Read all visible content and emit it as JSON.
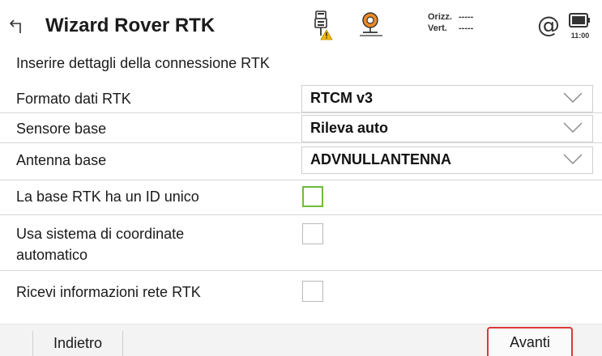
{
  "header": {
    "title": "Wizard Rover RTK",
    "precision": {
      "horizontal_label": "Orizz.",
      "horizontal_value": "-----",
      "vertical_label": "Vert.",
      "vertical_value": "-----"
    },
    "at_symbol": "@",
    "battery_time": "11:00",
    "icons": [
      "back-arrow-icon",
      "gnss-receiver-warning-icon",
      "radio-link-icon",
      "at-icon",
      "battery-icon"
    ]
  },
  "subtitle": "Inserire dettagli della connessione RTK",
  "form": {
    "format_label": "Formato dati RTK",
    "format_value": "RTCM v3",
    "sensor_label": "Sensore base",
    "sensor_value": "Rileva auto",
    "antenna_label": "Antenna base",
    "antenna_value": "ADVNULLANTENNA",
    "unique_id_label": "La base RTK ha un ID unico",
    "unique_id_checked": false,
    "auto_coord_label_line1": "Usa sistema di coordinate",
    "auto_coord_label_line2": "automatico",
    "auto_coord_checked": false,
    "network_info_label": "Ricevi informazioni rete RTK",
    "network_info_checked": false
  },
  "footer": {
    "back_label": "Indietro",
    "next_label": "Avanti"
  },
  "colors": {
    "focus_green": "#6dbb3b",
    "next_highlight_red": "#d93a3a",
    "warning_yellow": "#f5b800",
    "radio_orange": "#f08a24"
  }
}
